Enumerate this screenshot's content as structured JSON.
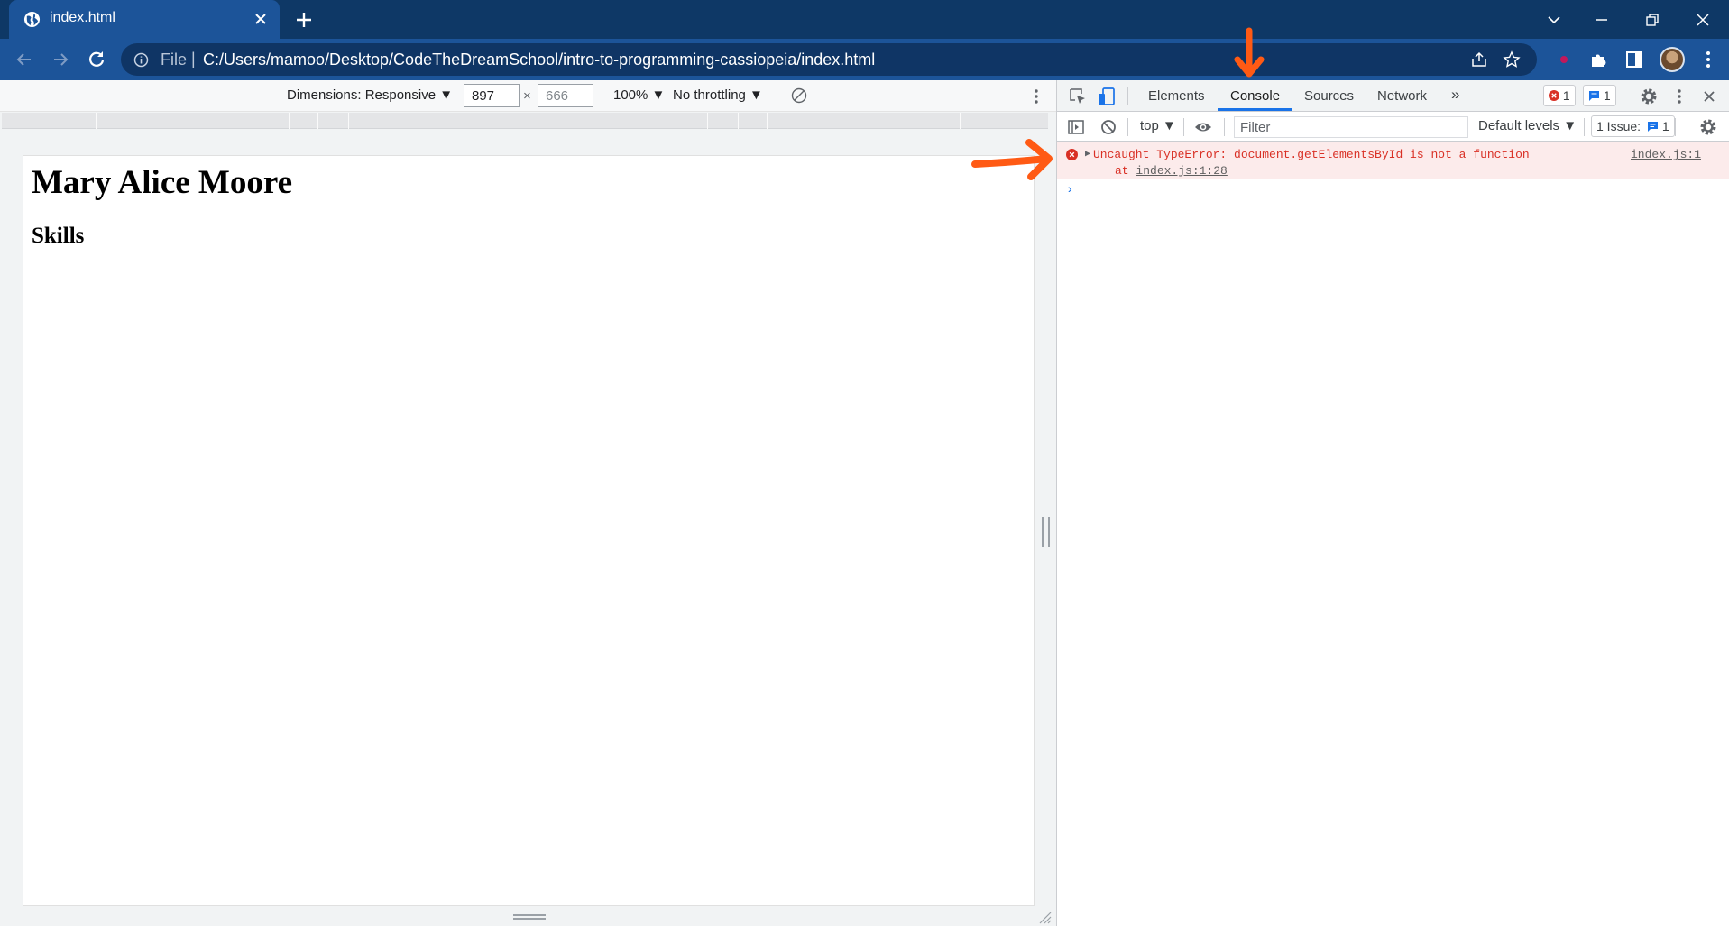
{
  "browser": {
    "tab_title": "index.html",
    "address_scheme": "File",
    "address_separator": "|",
    "url": "C:/Users/mamoo/Desktop/CodeTheDreamSchool/intro-to-programming-cassiopeia/index.html",
    "colors": {
      "titlebar": "#0e3866",
      "toolbar": "#1c5499",
      "omnibox": "#0f3565"
    }
  },
  "device_toolbar": {
    "dimensions_label": "Dimensions: Responsive",
    "width_value": "897",
    "times": "×",
    "height_placeholder": "666",
    "zoom": "100%",
    "throttling": "No throttling"
  },
  "page": {
    "heading": "Mary Alice Moore",
    "subheading": "Skills"
  },
  "devtools": {
    "tabs": [
      "Elements",
      "Console",
      "Sources",
      "Network"
    ],
    "active_tab": "Console",
    "overflow": "»",
    "error_count": "1",
    "message_count": "1",
    "context": "top",
    "filter_placeholder": "Filter",
    "levels": "Default levels",
    "issues_label": "1 Issue:",
    "issues_count": "1",
    "console": {
      "error_message": "Uncaught TypeError: document.getElementsById is not a function",
      "error_at": "at",
      "error_location": "index.js:1:28",
      "error_source": "index.js:1",
      "prompt": "›"
    },
    "colors": {
      "accent": "#1a73e8",
      "error": "#d93025",
      "error_bg": "#fcebeb"
    }
  },
  "annotations": {
    "arrow_color": "#ff5a14"
  }
}
